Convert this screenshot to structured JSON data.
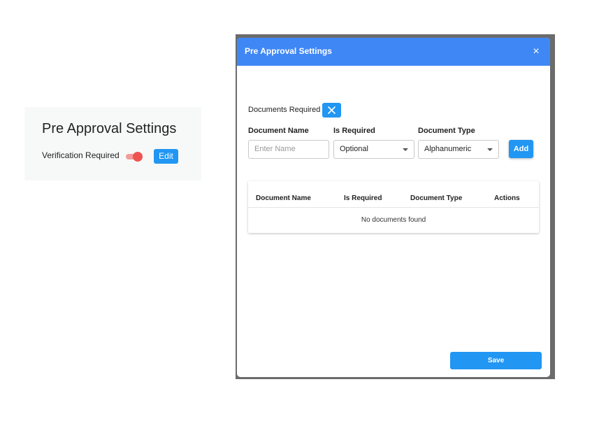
{
  "background_card": {
    "title": "Pre Approval Settings",
    "verification_label": "Verification Required",
    "verification_enabled": true,
    "edit_label": "Edit"
  },
  "modal": {
    "title": "Pre Approval Settings",
    "close_glyph": "×",
    "documents_required_label": "Documents Required",
    "form": {
      "name_label": "Document Name",
      "name_placeholder": "Enter Name",
      "required_label": "Is Required",
      "required_value": "Optional",
      "type_label": "Document Type",
      "type_value": "Alphanumeric",
      "add_label": "Add"
    },
    "table": {
      "headers": [
        "Document Name",
        "Is Required",
        "Document Type",
        "Actions"
      ],
      "empty_text": "No documents found"
    },
    "save_label": "Save"
  },
  "colors": {
    "accent": "#2196f3",
    "header": "#3f87f5",
    "toggle_on": "#ef5350"
  },
  "icons": {
    "close": "close-icon",
    "documents_toggle": "close-icon",
    "dropdown": "chevron-down-icon"
  }
}
